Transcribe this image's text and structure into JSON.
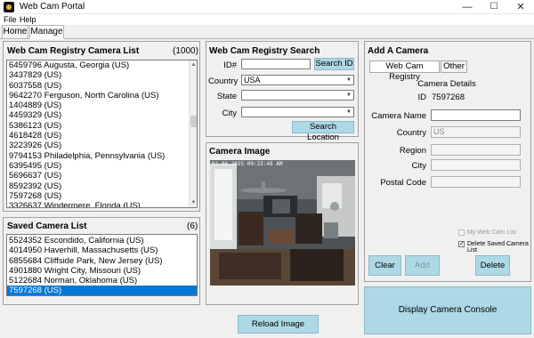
{
  "window": {
    "title": "Web Cam Portal",
    "minimize": "—",
    "maximize": "☐",
    "close": "✕"
  },
  "menu": {
    "file": "File",
    "help": "Help"
  },
  "tabs": [
    {
      "label": "Home"
    },
    {
      "label": "Manage"
    }
  ],
  "registry": {
    "title": "Web Cam Registry Camera List",
    "count": "(1000)",
    "items": [
      "6459796 Augusta, Georgia (US)",
      "3437829 (US)",
      "6037558 (US)",
      "9642270 Ferguson, North Carolina (US)",
      "1404889 (US)",
      "4459329 (US)",
      "5386123 (US)",
      "4618428 (US)",
      "3223926 (US)",
      "9794153 Philadelphia, Pennsylvania (US)",
      "6395495 (US)",
      "5696637 (US)",
      "8592392 (US)",
      "7597268 (US)",
      "3326637 Windermere, Florida (US)"
    ]
  },
  "saved": {
    "title": "Saved Camera List",
    "count": "(6)",
    "items": [
      "5524352 Escondido, California (US)",
      "4014950 Haverhill, Massachusetts (US)",
      "6855684 Cliffside Park, New Jersey (US)",
      "4901880 Wright City, Missouri (US)",
      "5122684 Norman, Oklahoma (US)",
      "7597268 (US)"
    ],
    "selected_index": 5
  },
  "search": {
    "title": "Web Cam Registry Search",
    "id_label": "ID#",
    "id_value": "",
    "search_id_button": "Search ID",
    "country_label": "Country",
    "country_value": "USA",
    "state_label": "State",
    "state_value": "",
    "city_label": "City",
    "city_value": "",
    "search_location_button": "Search Location"
  },
  "camera_image": {
    "title": "Camera Image",
    "timestamp": "02-06-2025 09:23:48 AM",
    "reload_button": "Reload Image"
  },
  "add_camera": {
    "title": "Add A Camera",
    "tabs": [
      {
        "label": "Web Cam Registry"
      },
      {
        "label": "Other"
      }
    ],
    "details_heading": "Camera Details",
    "id_label": "ID",
    "id_value": "7597268",
    "camera_name_label": "Camera Name",
    "camera_name_value": "",
    "country_label": "Country",
    "country_value": "US",
    "region_label": "Region",
    "region_value": "",
    "city_label": "City",
    "city_value": "",
    "postal_label": "Postal Code",
    "postal_value": "",
    "my_web_cam_list_label": "My Web Cam List",
    "my_web_cam_list_checked": false,
    "delete_saved_label": "Delete Saved Camera List",
    "delete_saved_checked": true,
    "clear_button": "Clear",
    "add_button": "Add",
    "delete_button": "Delete",
    "console_button": "Display Camera Console"
  },
  "colors": {
    "accent_button": "#add8e6",
    "selection": "#0078d7"
  }
}
